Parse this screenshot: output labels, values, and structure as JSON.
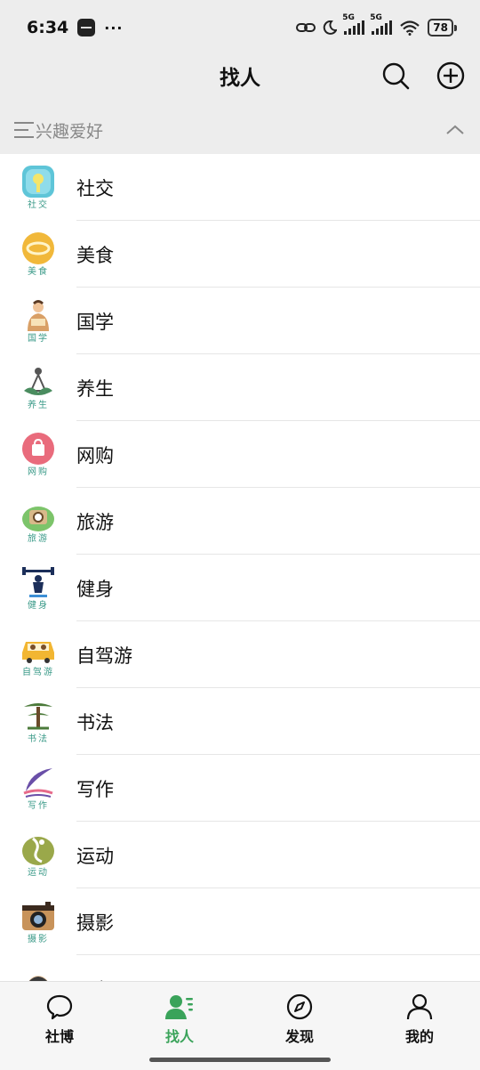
{
  "status_bar": {
    "time": "6:34",
    "dots": "···",
    "network_1": "5G",
    "network_2": "5G",
    "battery": "78"
  },
  "header": {
    "title": "找人"
  },
  "section": {
    "label": "兴趣爱好"
  },
  "categories": [
    {
      "label": "社交",
      "caption": "社交",
      "icon": "social-icon"
    },
    {
      "label": "美食",
      "caption": "美食",
      "icon": "food-icon"
    },
    {
      "label": "国学",
      "caption": "国学",
      "icon": "sinology-icon"
    },
    {
      "label": "养生",
      "caption": "养生",
      "icon": "wellness-icon"
    },
    {
      "label": "网购",
      "caption": "网购",
      "icon": "shopping-icon"
    },
    {
      "label": "旅游",
      "caption": "旅游",
      "icon": "travel-icon"
    },
    {
      "label": "健身",
      "caption": "健身",
      "icon": "fitness-icon"
    },
    {
      "label": "自驾游",
      "caption": "自驾游",
      "icon": "road-trip-icon"
    },
    {
      "label": "书法",
      "caption": "书法",
      "icon": "calligraphy-icon"
    },
    {
      "label": "写作",
      "caption": "写作",
      "icon": "writing-icon"
    },
    {
      "label": "运动",
      "caption": "运动",
      "icon": "sports-icon"
    },
    {
      "label": "摄影",
      "caption": "摄影",
      "icon": "photography-icon"
    },
    {
      "label": "工程",
      "caption": "",
      "icon": "engineering-icon"
    }
  ],
  "bottom_nav": [
    {
      "label": "社博",
      "icon": "chat-bubble-icon",
      "active": false
    },
    {
      "label": "找人",
      "icon": "find-people-icon",
      "active": true
    },
    {
      "label": "发现",
      "icon": "compass-icon",
      "active": false
    },
    {
      "label": "我的",
      "icon": "profile-icon",
      "active": false
    }
  ],
  "colors": {
    "accent": "#3aa35a",
    "caption": "#3a9a88",
    "background": "#ededed"
  }
}
